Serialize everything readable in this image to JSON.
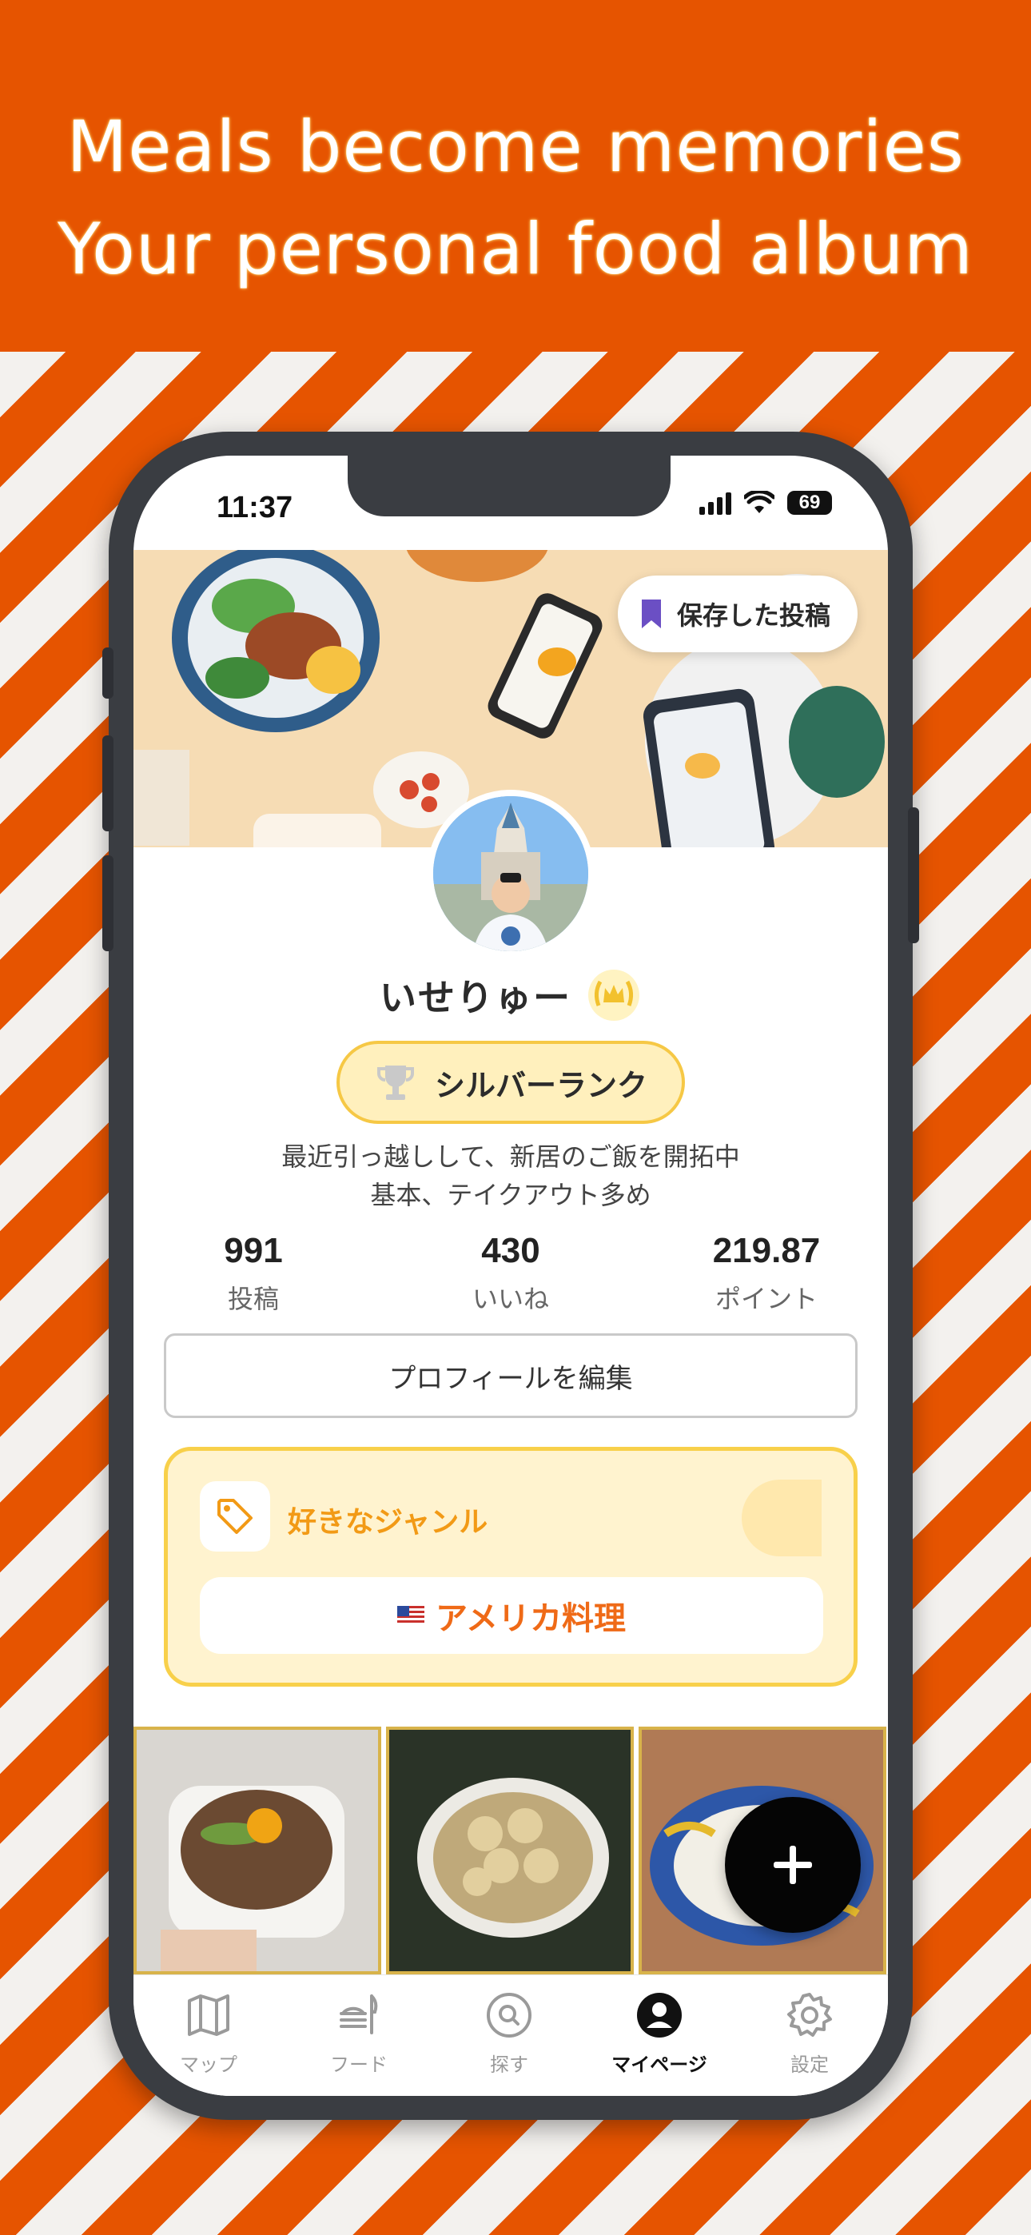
{
  "headline": {
    "line1": "Meals become memories",
    "line2": "Your personal food album"
  },
  "status_bar": {
    "time": "11:37",
    "battery": "69"
  },
  "cover": {
    "saved_posts_label": "保存した投稿"
  },
  "profile": {
    "username": "いせりゅー",
    "rank_label": "シルバーランク",
    "bio_line1": "最近引っ越しして、新居のご飯を開拓中",
    "bio_line2": "基本、テイクアウト多め",
    "edit_profile_label": "プロフィールを編集"
  },
  "stats": [
    {
      "value": "991",
      "label": "投稿"
    },
    {
      "value": "430",
      "label": "いいね"
    },
    {
      "value": "219.87",
      "label": "ポイント"
    }
  ],
  "favorite_genre": {
    "title": "好きなジャンル",
    "genre": "アメリカ料理",
    "flag_icon": "us-flag-icon"
  },
  "photo_grid": {
    "items": [
      "beef-bowl-photo",
      "dumpling-soup-photo",
      "dessert-plate-photo"
    ]
  },
  "fab_icon": "plus-icon",
  "tabbar": {
    "items": [
      {
        "label": "マップ",
        "icon": "map-icon",
        "active": false
      },
      {
        "label": "フード",
        "icon": "food-icon",
        "active": false
      },
      {
        "label": "探す",
        "icon": "search-icon",
        "active": false
      },
      {
        "label": "マイページ",
        "icon": "profile-icon",
        "active": true
      },
      {
        "label": "設定",
        "icon": "gear-icon",
        "active": false
      }
    ]
  },
  "colors": {
    "background": "#e65400",
    "stripe": "#f3f1ee",
    "accent_orange": "#f29a16",
    "rank_fill": "#fff0bd",
    "rank_border": "#f6c845"
  }
}
